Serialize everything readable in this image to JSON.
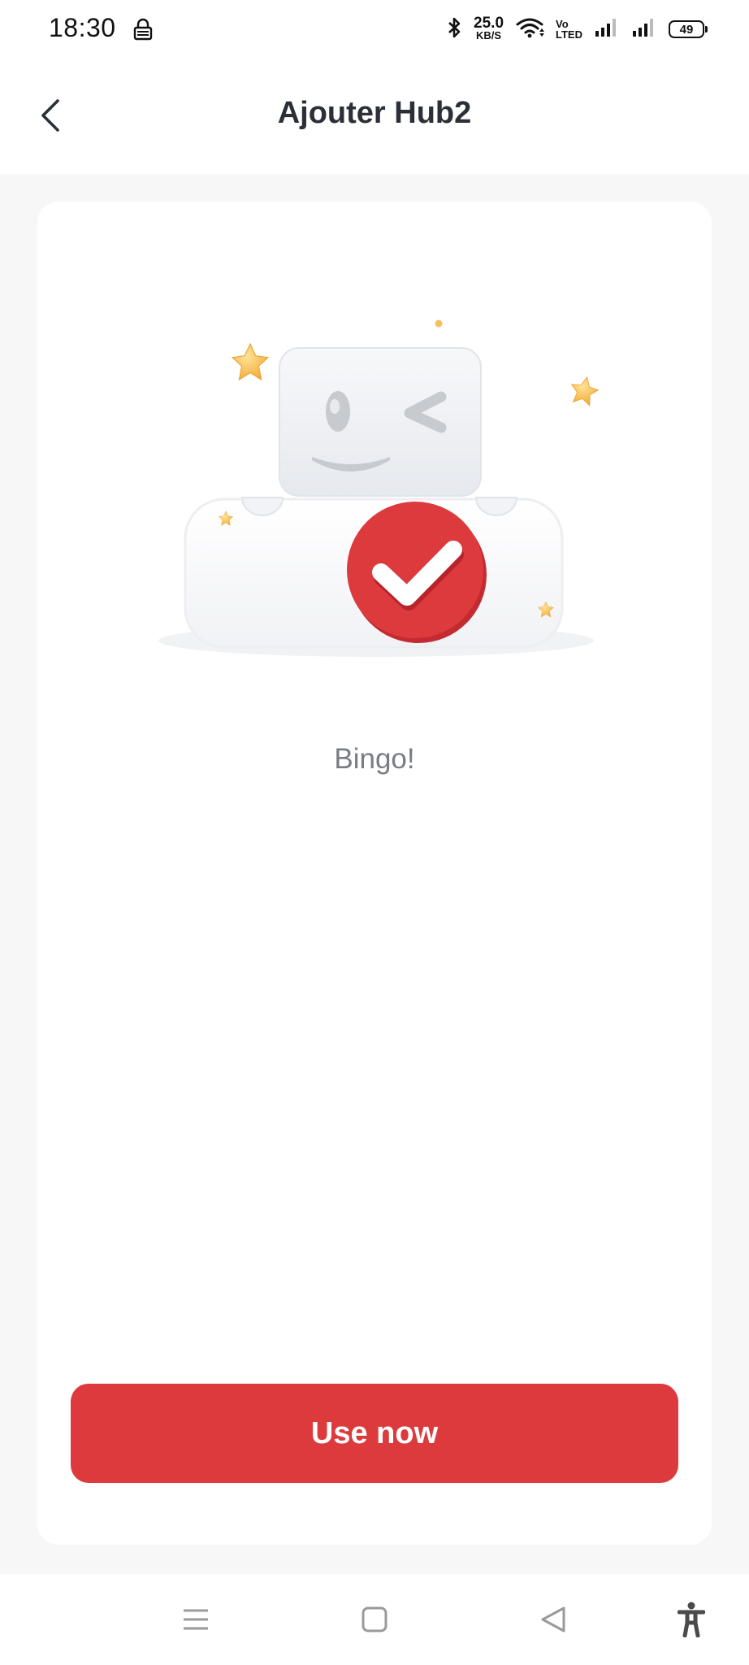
{
  "status_bar": {
    "time": "18:30",
    "net_speed_value": "25.0",
    "net_speed_unit": "KB/S",
    "volte_top": "Vo",
    "volte_bottom": "LTED",
    "battery": "49"
  },
  "header": {
    "title": "Ajouter Hub2"
  },
  "main": {
    "message": "Bingo!",
    "action_label": "Use now"
  },
  "icons": {
    "back": "chevron-left-icon",
    "lock": "lock-icon",
    "bluetooth": "bluetooth-icon",
    "wifi": "wifi-icon",
    "signal": "signal-icon",
    "menu": "menu-icon",
    "home": "home-icon",
    "back_nav": "back-triangle-icon",
    "accessibility": "accessibility-icon"
  },
  "colors": {
    "accent": "#dc3a3c",
    "title": "#2b2f38",
    "message": "#777c86",
    "star": "#f5b83d"
  }
}
